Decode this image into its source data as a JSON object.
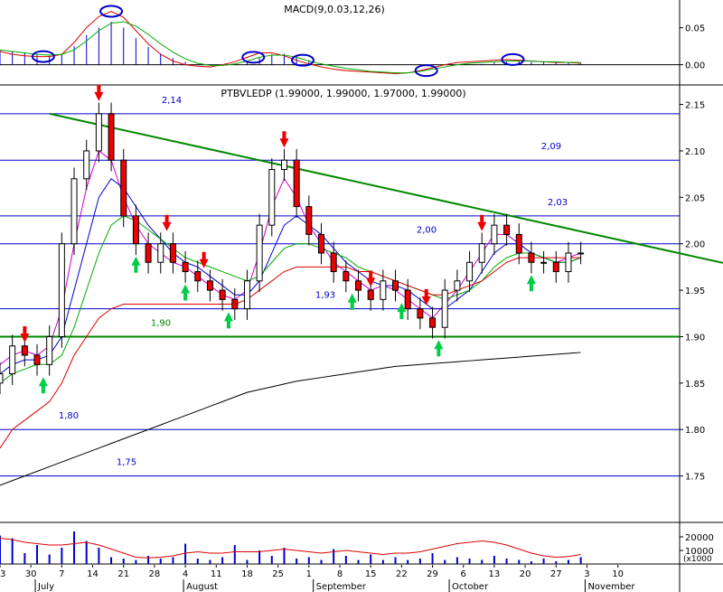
{
  "chart_data": [
    {
      "type": "bar",
      "panel": "macd",
      "title": "MACD(9,0.03,12,26)",
      "axis_ticks": [
        "0.05",
        "0.00"
      ],
      "ylim": [
        -0.02,
        0.08
      ],
      "x": [
        0,
        2,
        4,
        6,
        8,
        10,
        12,
        14,
        16,
        18,
        20,
        22,
        24,
        26,
        28,
        30,
        32,
        34,
        36,
        38,
        40,
        42,
        44,
        46,
        48,
        50,
        52,
        54,
        56,
        58,
        60,
        62,
        64,
        66,
        68,
        70,
        72,
        74,
        76,
        78,
        80,
        82,
        84,
        86,
        88,
        90,
        92,
        94
      ],
      "series": [
        {
          "role": "histogram",
          "values": [
            0.02,
            0.018,
            0.016,
            0.014,
            0.012,
            0.014,
            0.025,
            0.04,
            0.05,
            0.058,
            0.05,
            0.036,
            0.024,
            0.015,
            0.009,
            0.004,
            0.001,
            0.0,
            0.0,
            0.0,
            0.003,
            0.009,
            0.014,
            0.015,
            0.011,
            0.006,
            0.002,
            0.0,
            0.0,
            0.0,
            0.0,
            0.0,
            0.0,
            0.0,
            0.0,
            0.0,
            0.0,
            0.0,
            0.0,
            0.001,
            0.003,
            0.004,
            0.005,
            0.004,
            0.004,
            0.003,
            0.003,
            0.002
          ]
        },
        {
          "role": "macd",
          "values": [
            0.018,
            0.014,
            0.012,
            0.011,
            0.011,
            0.014,
            0.03,
            0.05,
            0.065,
            0.072,
            0.064,
            0.046,
            0.028,
            0.014,
            0.005,
            0.0,
            -0.002,
            -0.003,
            0.0,
            0.004,
            0.01,
            0.016,
            0.016,
            0.012,
            0.006,
            0.001,
            -0.003,
            -0.006,
            -0.008,
            -0.009,
            -0.01,
            -0.011,
            -0.012,
            -0.011,
            -0.008,
            -0.004,
            0.0,
            0.003,
            0.004,
            0.005,
            0.006,
            0.007,
            0.006,
            0.005,
            0.004,
            0.003,
            0.003,
            0.002
          ]
        },
        {
          "role": "signal",
          "values": [
            0.02,
            0.018,
            0.016,
            0.014,
            0.013,
            0.014,
            0.02,
            0.032,
            0.046,
            0.056,
            0.058,
            0.052,
            0.041,
            0.028,
            0.017,
            0.008,
            0.002,
            -0.001,
            -0.001,
            0.001,
            0.005,
            0.01,
            0.013,
            0.013,
            0.01,
            0.005,
            0.001,
            -0.002,
            -0.005,
            -0.007,
            -0.009,
            -0.01,
            -0.011,
            -0.011,
            -0.009,
            -0.006,
            -0.003,
            0.0,
            0.002,
            0.003,
            0.004,
            0.005,
            0.005,
            0.005,
            0.004,
            0.004,
            0.003,
            0.003
          ]
        }
      ]
    },
    {
      "type": "candlestick",
      "panel": "price",
      "title": "PTBVLEDP (1.99000, 1.99000, 1.97000, 1.99000)",
      "axis_ticks": [
        "2.15",
        "2.10",
        "2.05",
        "2.00",
        "1.95",
        "1.90",
        "1.85",
        "1.80",
        "1.75"
      ],
      "ylim": [
        1.7,
        2.17
      ],
      "x": [
        0,
        2,
        4,
        6,
        8,
        10,
        12,
        14,
        16,
        18,
        20,
        22,
        24,
        26,
        28,
        30,
        32,
        34,
        36,
        38,
        40,
        42,
        44,
        46,
        48,
        50,
        52,
        54,
        56,
        58,
        60,
        62,
        64,
        66,
        68,
        70,
        72,
        74,
        76,
        78,
        80,
        82,
        84,
        86,
        88,
        90,
        92,
        94
      ],
      "close": [
        1.86,
        1.89,
        1.88,
        1.87,
        1.9,
        2.0,
        2.07,
        2.1,
        2.14,
        2.09,
        2.03,
        2.0,
        1.98,
        2.0,
        1.98,
        1.97,
        1.96,
        1.95,
        1.94,
        1.93,
        1.96,
        2.02,
        2.08,
        2.09,
        2.04,
        2.01,
        1.99,
        1.97,
        1.96,
        1.95,
        1.94,
        1.96,
        1.95,
        1.93,
        1.92,
        1.91,
        1.95,
        1.96,
        1.98,
        2.0,
        2.02,
        2.01,
        1.99,
        1.98,
        1.98,
        1.97,
        1.99,
        1.99
      ],
      "series": [
        {
          "role": "ma-fast",
          "color": "#cc00cc",
          "values": [
            1.87,
            1.88,
            1.885,
            1.88,
            1.89,
            1.93,
            2.0,
            2.06,
            2.1,
            2.09,
            2.05,
            2.02,
            2.0,
            1.99,
            1.98,
            1.975,
            1.965,
            1.955,
            1.945,
            1.94,
            1.95,
            1.99,
            2.04,
            2.07,
            2.05,
            2.02,
            2.0,
            1.98,
            1.97,
            1.96,
            1.95,
            1.955,
            1.95,
            1.94,
            1.93,
            1.92,
            1.935,
            1.95,
            1.97,
            1.99,
            2.01,
            2.01,
            2.0,
            1.99,
            1.985,
            1.98,
            1.985,
            1.99
          ]
        },
        {
          "role": "ma-medium",
          "color": "#0000cc",
          "values": [
            1.86,
            1.87,
            1.875,
            1.875,
            1.88,
            1.9,
            1.95,
            2.0,
            2.05,
            2.07,
            2.06,
            2.04,
            2.02,
            2.005,
            1.99,
            1.98,
            1.975,
            1.965,
            1.955,
            1.945,
            1.945,
            1.96,
            1.99,
            2.02,
            2.03,
            2.02,
            2.01,
            1.995,
            1.98,
            1.97,
            1.96,
            1.955,
            1.955,
            1.95,
            1.94,
            1.93,
            1.93,
            1.94,
            1.95,
            1.97,
            1.99,
            2.0,
            2.0,
            1.99,
            1.985,
            1.98,
            1.98,
            1.985
          ]
        },
        {
          "role": "ma-slow",
          "color": "#00aa00",
          "values": [
            1.85,
            1.86,
            1.865,
            1.87,
            1.87,
            1.88,
            1.91,
            1.95,
            1.99,
            2.02,
            2.03,
            2.025,
            2.015,
            2.005,
            1.995,
            1.985,
            1.98,
            1.975,
            1.97,
            1.965,
            1.96,
            1.965,
            1.98,
            1.995,
            2.0,
            2.0,
            1.995,
            1.99,
            1.985,
            1.975,
            1.97,
            1.965,
            1.96,
            1.955,
            1.95,
            1.945,
            1.94,
            1.945,
            1.95,
            1.96,
            1.975,
            1.985,
            1.99,
            1.99,
            1.985,
            1.98,
            1.98,
            1.985
          ]
        },
        {
          "role": "ma-long",
          "color": "#dd0000",
          "values": [
            1.78,
            1.8,
            1.81,
            1.82,
            1.83,
            1.85,
            1.88,
            1.9,
            1.92,
            1.93,
            1.935,
            1.935,
            1.935,
            1.935,
            1.935,
            1.935,
            1.935,
            1.935,
            1.935,
            1.935,
            1.94,
            1.95,
            1.96,
            1.97,
            1.975,
            1.975,
            1.975,
            1.975,
            1.975,
            1.97,
            1.97,
            1.965,
            1.96,
            1.955,
            1.95,
            1.945,
            1.945,
            1.95,
            1.955,
            1.96,
            1.97,
            1.98,
            1.985,
            1.985,
            1.985,
            1.985,
            1.985,
            1.985
          ]
        },
        {
          "role": "ma-very-long",
          "color": "#000000",
          "values": [
            1.74,
            1.745,
            1.75,
            1.755,
            1.76,
            1.765,
            1.77,
            1.775,
            1.78,
            1.785,
            1.79,
            1.795,
            1.8,
            1.805,
            1.81,
            1.815,
            1.82,
            1.825,
            1.83,
            1.835,
            1.84,
            1.843,
            1.846,
            1.849,
            1.852,
            1.854,
            1.856,
            1.858,
            1.86,
            1.862,
            1.864,
            1.866,
            1.868,
            1.869,
            1.87,
            1.871,
            1.872,
            1.873,
            1.874,
            1.875,
            1.876,
            1.877,
            1.878,
            1.879,
            1.88,
            1.881,
            1.882,
            1.883
          ]
        }
      ],
      "levels": [
        {
          "value": 2.14,
          "label": "2,14",
          "color": "#0000cc"
        },
        {
          "value": 2.09,
          "label": "2,09",
          "color": "#0000cc"
        },
        {
          "value": 2.03,
          "label": "2,03",
          "color": "#0000cc"
        },
        {
          "value": 2.0,
          "label": "2,00",
          "color": "#0000cc"
        },
        {
          "value": 1.93,
          "label": "1,93",
          "color": "#0000cc"
        },
        {
          "value": 1.9,
          "label": "1,90",
          "color": "#008800"
        },
        {
          "value": 1.8,
          "label": "1,80",
          "color": "#0000cc"
        },
        {
          "value": 1.75,
          "label": "1,75",
          "color": "#0000cc"
        }
      ],
      "trendline": {
        "from": [
          8,
          2.14
        ],
        "to": [
          120,
          1.975
        ],
        "color": "#008800"
      }
    },
    {
      "type": "bar",
      "panel": "volume",
      "axis_ticks": [
        "20000",
        "10000"
      ],
      "axis_unit": "(x1000",
      "ylim": [
        0,
        30000
      ],
      "x": [
        0,
        2,
        4,
        6,
        8,
        10,
        12,
        14,
        16,
        18,
        20,
        22,
        24,
        26,
        28,
        30,
        32,
        34,
        36,
        38,
        40,
        42,
        44,
        46,
        48,
        50,
        52,
        54,
        56,
        58,
        60,
        62,
        64,
        66,
        68,
        70,
        72,
        74,
        76,
        78,
        80,
        82,
        84,
        86,
        88,
        90,
        92,
        94
      ],
      "values": [
        21000,
        19000,
        8000,
        14000,
        7000,
        12000,
        24000,
        17000,
        12000,
        5000,
        4000,
        3000,
        6000,
        4000,
        5000,
        15000,
        4000,
        3000,
        5000,
        14000,
        3000,
        10000,
        6000,
        12000,
        4000,
        5000,
        3000,
        11000,
        6000,
        3000,
        7000,
        3000,
        5000,
        3000,
        4000,
        8000,
        3000,
        5000,
        4000,
        3000,
        6000,
        4000,
        3000,
        2000,
        4000,
        2000,
        3000,
        5000
      ],
      "series": [
        {
          "role": "volume-ma",
          "values": [
            19000,
            18000,
            16000,
            15000,
            14000,
            14000,
            15000,
            16000,
            14000,
            11000,
            8000,
            5000,
            4500,
            5000,
            6000,
            8000,
            9000,
            8000,
            8000,
            9000,
            9000,
            9000,
            10000,
            11000,
            10000,
            9000,
            8000,
            9000,
            10000,
            9000,
            8000,
            7000,
            8000,
            8000,
            9000,
            11000,
            13000,
            15000,
            16000,
            17000,
            16000,
            14000,
            11000,
            8000,
            6000,
            5000,
            5500,
            7000
          ]
        }
      ]
    }
  ],
  "x_axis": {
    "day_labels": [
      {
        "t": 0,
        "label": "23"
      },
      {
        "t": 5,
        "label": "30"
      },
      {
        "t": 10,
        "label": "7"
      },
      {
        "t": 15,
        "label": "14"
      },
      {
        "t": 20,
        "label": "21"
      },
      {
        "t": 25,
        "label": "28"
      },
      {
        "t": 30,
        "label": "4"
      },
      {
        "t": 35,
        "label": "11"
      },
      {
        "t": 40,
        "label": "18"
      },
      {
        "t": 45,
        "label": "25"
      },
      {
        "t": 50,
        "label": "1"
      },
      {
        "t": 55,
        "label": "8"
      },
      {
        "t": 60,
        "label": "15"
      },
      {
        "t": 65,
        "label": "22"
      },
      {
        "t": 70,
        "label": "29"
      },
      {
        "t": 75,
        "label": "6"
      },
      {
        "t": 80,
        "label": "13"
      },
      {
        "t": 85,
        "label": "20"
      },
      {
        "t": 90,
        "label": "27"
      },
      {
        "t": 95,
        "label": "3"
      },
      {
        "t": 100,
        "label": "10"
      }
    ],
    "month_labels": [
      {
        "t": 6,
        "label": "July"
      },
      {
        "t": 30,
        "label": "August"
      },
      {
        "t": 51,
        "label": "September"
      },
      {
        "t": 73,
        "label": "October"
      },
      {
        "t": 95,
        "label": "November"
      }
    ],
    "range": [
      0,
      110
    ]
  },
  "annotations": {
    "buy_color": "#00cc44",
    "sell_color": "#ee0000",
    "buy_arrows_t": [
      7,
      22,
      30,
      37,
      57,
      65,
      71,
      86
    ],
    "sell_arrows_t": [
      4,
      16,
      27,
      33,
      46,
      60,
      69,
      78
    ],
    "macd_circles_t": [
      7,
      18,
      41,
      49,
      69,
      83
    ]
  },
  "colors": {
    "axis": "#000000",
    "grid": "#000000",
    "level_blue": "#0000cc",
    "level_green": "#008800"
  }
}
